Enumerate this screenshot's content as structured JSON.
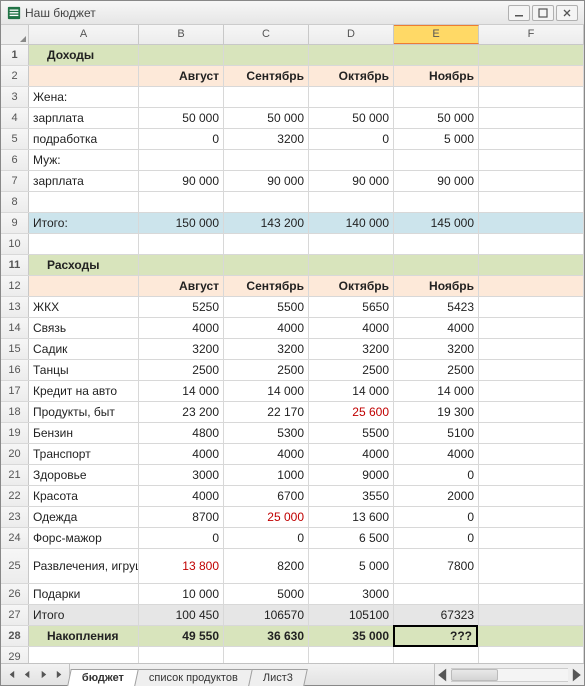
{
  "window": {
    "title": "Наш бюджет"
  },
  "columns": [
    "A",
    "B",
    "C",
    "D",
    "E",
    "F"
  ],
  "incomes": {
    "header": "Доходы",
    "months": [
      "Август",
      "Сентябрь",
      "Октябрь",
      "Ноябрь"
    ],
    "wife_label": "Жена:",
    "husband_label": "Муж:",
    "rows": {
      "wife_salary": {
        "label": "зарплата",
        "vals": [
          "50 000",
          "50 000",
          "50 000",
          "50 000"
        ]
      },
      "wife_side": {
        "label": "подработка",
        "vals": [
          "0",
          "3200",
          "0",
          "5 000"
        ]
      },
      "husb_salary": {
        "label": "зарплата",
        "vals": [
          "90 000",
          "90 000",
          "90 000",
          "90 000"
        ]
      }
    },
    "total": {
      "label": "Итого:",
      "vals": [
        "150 000",
        "143 200",
        "140 000",
        "145 000"
      ]
    }
  },
  "expenses": {
    "header": "Расходы",
    "months": [
      "Август",
      "Сентябрь",
      "Октябрь",
      "Ноябрь"
    ],
    "rows": [
      {
        "label": "ЖКХ",
        "vals": [
          "5250",
          "5500",
          "5650",
          "5423"
        ]
      },
      {
        "label": "Связь",
        "vals": [
          "4000",
          "4000",
          "4000",
          "4000"
        ]
      },
      {
        "label": "Садик",
        "vals": [
          "3200",
          "3200",
          "3200",
          "3200"
        ]
      },
      {
        "label": "Танцы",
        "vals": [
          "2500",
          "2500",
          "2500",
          "2500"
        ]
      },
      {
        "label": "Кредит на авто",
        "vals": [
          "14 000",
          "14 000",
          "14 000",
          "14 000"
        ]
      },
      {
        "label": "Продукты, быт",
        "vals": [
          "23 200",
          "22 170",
          "25 600",
          "19 300"
        ],
        "red": [
          false,
          false,
          true,
          false
        ]
      },
      {
        "label": "Бензин",
        "vals": [
          "4800",
          "5300",
          "5500",
          "5100"
        ]
      },
      {
        "label": "Транспорт",
        "vals": [
          "4000",
          "4000",
          "4000",
          "4000"
        ]
      },
      {
        "label": "Здоровье",
        "vals": [
          "3000",
          "1000",
          "9000",
          "0"
        ]
      },
      {
        "label": "Красота",
        "vals": [
          "4000",
          "6700",
          "3550",
          "2000"
        ]
      },
      {
        "label": "Одежда",
        "vals": [
          "8700",
          "25 000",
          "13 600",
          "0"
        ],
        "red": [
          false,
          true,
          false,
          false
        ]
      },
      {
        "label": "Форс-мажор",
        "vals": [
          "0",
          "0",
          "6 500",
          "0"
        ]
      },
      {
        "label": "Развлечения, игрушки, книжки",
        "vals": [
          "13 800",
          "8200",
          "5 000",
          "7800"
        ],
        "red": [
          true,
          false,
          false,
          false
        ],
        "tall": true
      },
      {
        "label": "Подарки",
        "vals": [
          "10 000",
          "5000",
          "3000",
          ""
        ]
      }
    ],
    "total": {
      "label": "Итого",
      "vals": [
        "100 450",
        "106570",
        "105100",
        "67323"
      ]
    }
  },
  "savings": {
    "label": "Накопления",
    "vals": [
      "49 550",
      "36 630",
      "35 000",
      "???"
    ]
  },
  "sheets": {
    "tabs": [
      "бюджет",
      "список продуктов",
      "Лист3"
    ],
    "active": 0
  }
}
